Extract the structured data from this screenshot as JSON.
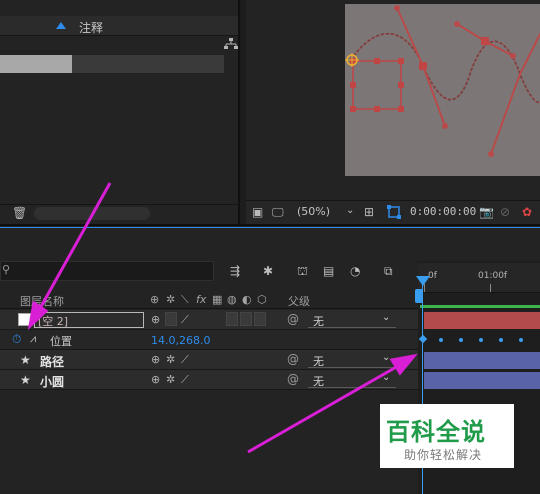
{
  "project_panel": {
    "column_comment": "注释",
    "hierarchy_icon": "flowchart-icon",
    "trash_icon": "trash-icon"
  },
  "viewer": {
    "zoom": "(50%)",
    "timecode": "0:00:00:00"
  },
  "timeline": {
    "ruler_labels": [
      "0f",
      "01:00f"
    ],
    "columns": {
      "layer_name": "图层名称",
      "parent": "父级"
    },
    "layers": [
      {
        "name": "[空 2]",
        "parent": "无"
      },
      {
        "name": "路径",
        "parent": "无"
      },
      {
        "name": "小圆",
        "parent": "无"
      }
    ],
    "property": {
      "name": "位置",
      "value": "14.0,268.0"
    },
    "colors": {
      "accent": "#2d8ceb",
      "null_track": "#b24c4c",
      "shape_track": "#5863a8",
      "work_area": "#3eb54a",
      "annotation_arrow": "#d91fd6"
    }
  },
  "watermark": {
    "title": "百科全说",
    "subtitle": "助你轻松解决"
  }
}
